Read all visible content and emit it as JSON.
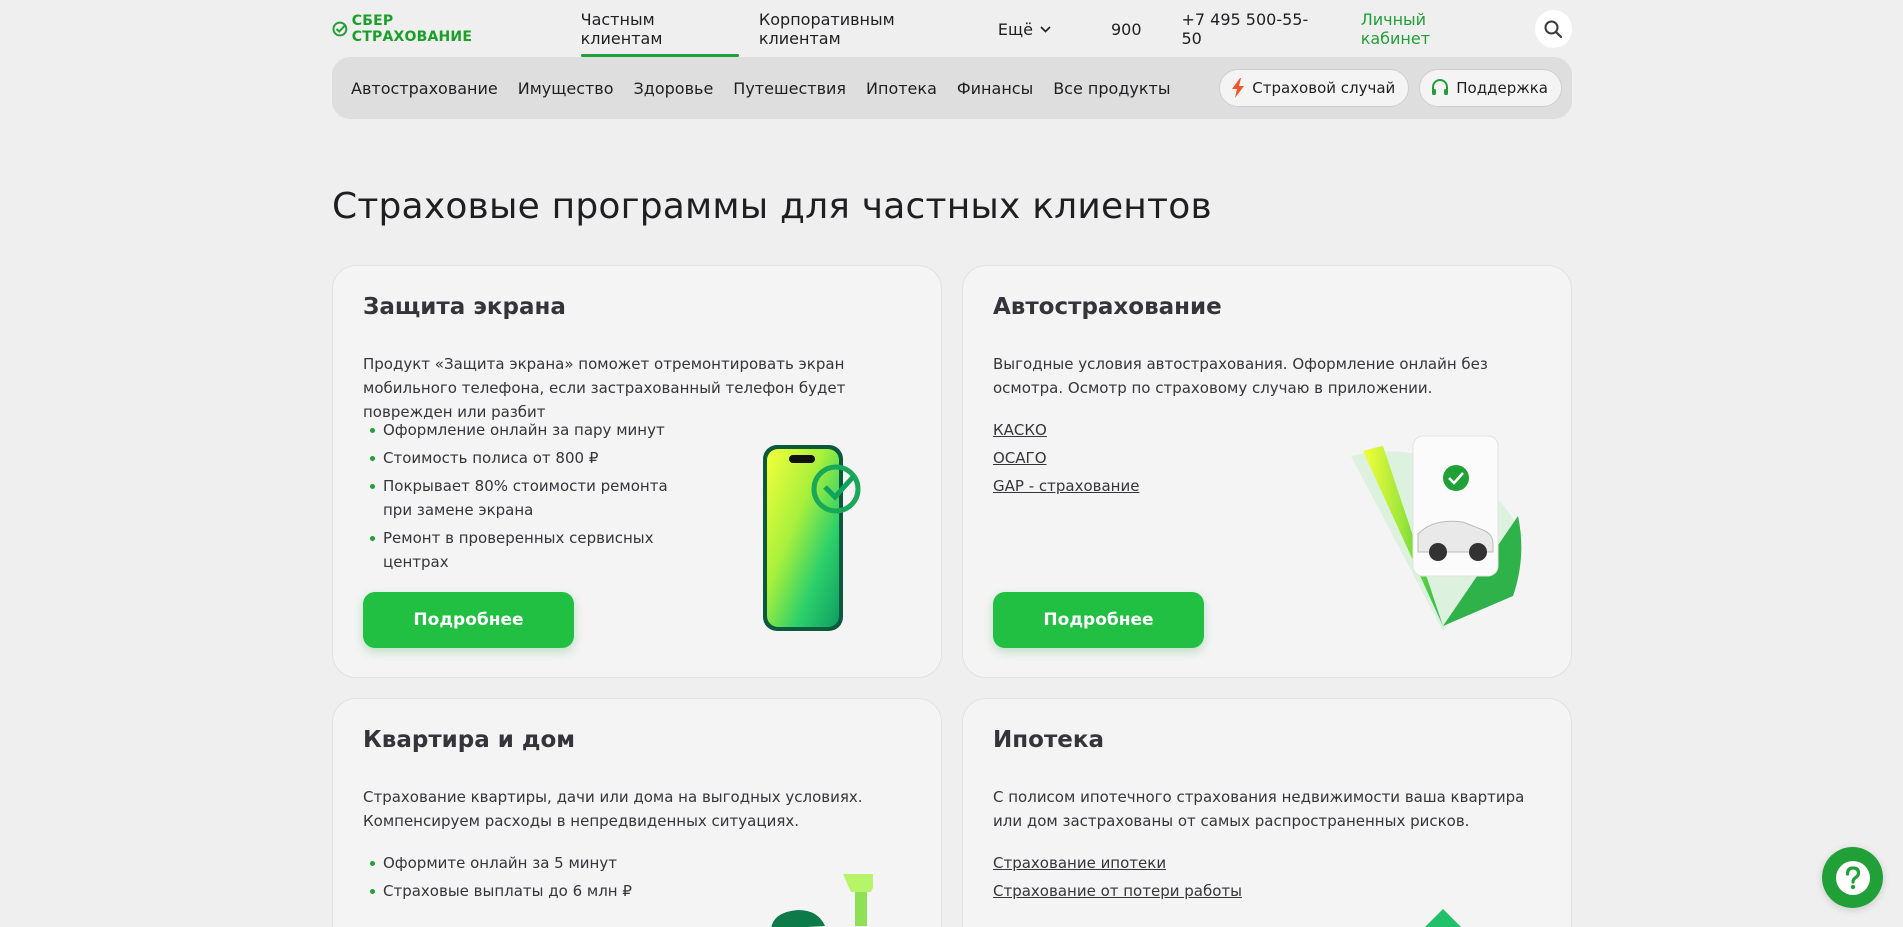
{
  "header": {
    "logo_text": "СБЕР СТРАХОВАНИЕ",
    "nav": [
      {
        "label": "Частным клиентам",
        "active": true
      },
      {
        "label": "Корпоративным клиентам",
        "active": false
      },
      {
        "label": "Ещё",
        "active": false
      }
    ],
    "short_number": "900",
    "phone": "+7 495 500-55-50",
    "cabinet": "Личный кабинет",
    "search_icon": "search-icon"
  },
  "subnav": {
    "items": [
      "Автострахование",
      "Имущество",
      "Здоровье",
      "Путешествия",
      "Ипотека",
      "Финансы",
      "Все продукты"
    ],
    "insurance_case": "Страховой случай",
    "support": "Поддержка"
  },
  "page_title": "Страховые программы для частных клиентов",
  "cards": [
    {
      "title": "Защита экрана",
      "description": "Продукт «Защита экрана» поможет отремонтировать экран мобильного телефона, если застрахованный телефон будет поврежден или разбит",
      "bullets": [
        "Оформление онлайн за пару минут",
        "Стоимость полиса от 800 ₽",
        "Покрывает 80% стоимости ремонта при замене экрана",
        "Ремонт в проверенных сервисных центрах"
      ],
      "button": "Подробнее"
    },
    {
      "title": "Автострахование",
      "description": "Выгодные условия автострахования. Оформление онлайн без осмотра. Осмотр по страховому случаю в приложении.",
      "links": [
        "КАСКО",
        "ОСАГО",
        "GAP - страхование"
      ],
      "button": "Подробнее"
    },
    {
      "title": "Квартира и дом",
      "description": "Страхование квартиры, дачи или дома на выгодных условиях. Компенсируем расходы в непредвиденных ситуациях.",
      "bullets": [
        "Оформите онлайн за 5 минут",
        "Страховые выплаты до 6 млн ₽"
      ]
    },
    {
      "title": "Ипотека",
      "description": "С полисом ипотечного страхования недвижимости ваша квартира или дом застрахованы от самых распространенных рисков.",
      "links": [
        "Страхование ипотеки",
        "Страхование от потери работы"
      ]
    }
  ],
  "colors": {
    "brand_green": "#21a038",
    "button_green": "#21c043",
    "background": "#efefef",
    "card_bg": "#f4f4f4"
  }
}
